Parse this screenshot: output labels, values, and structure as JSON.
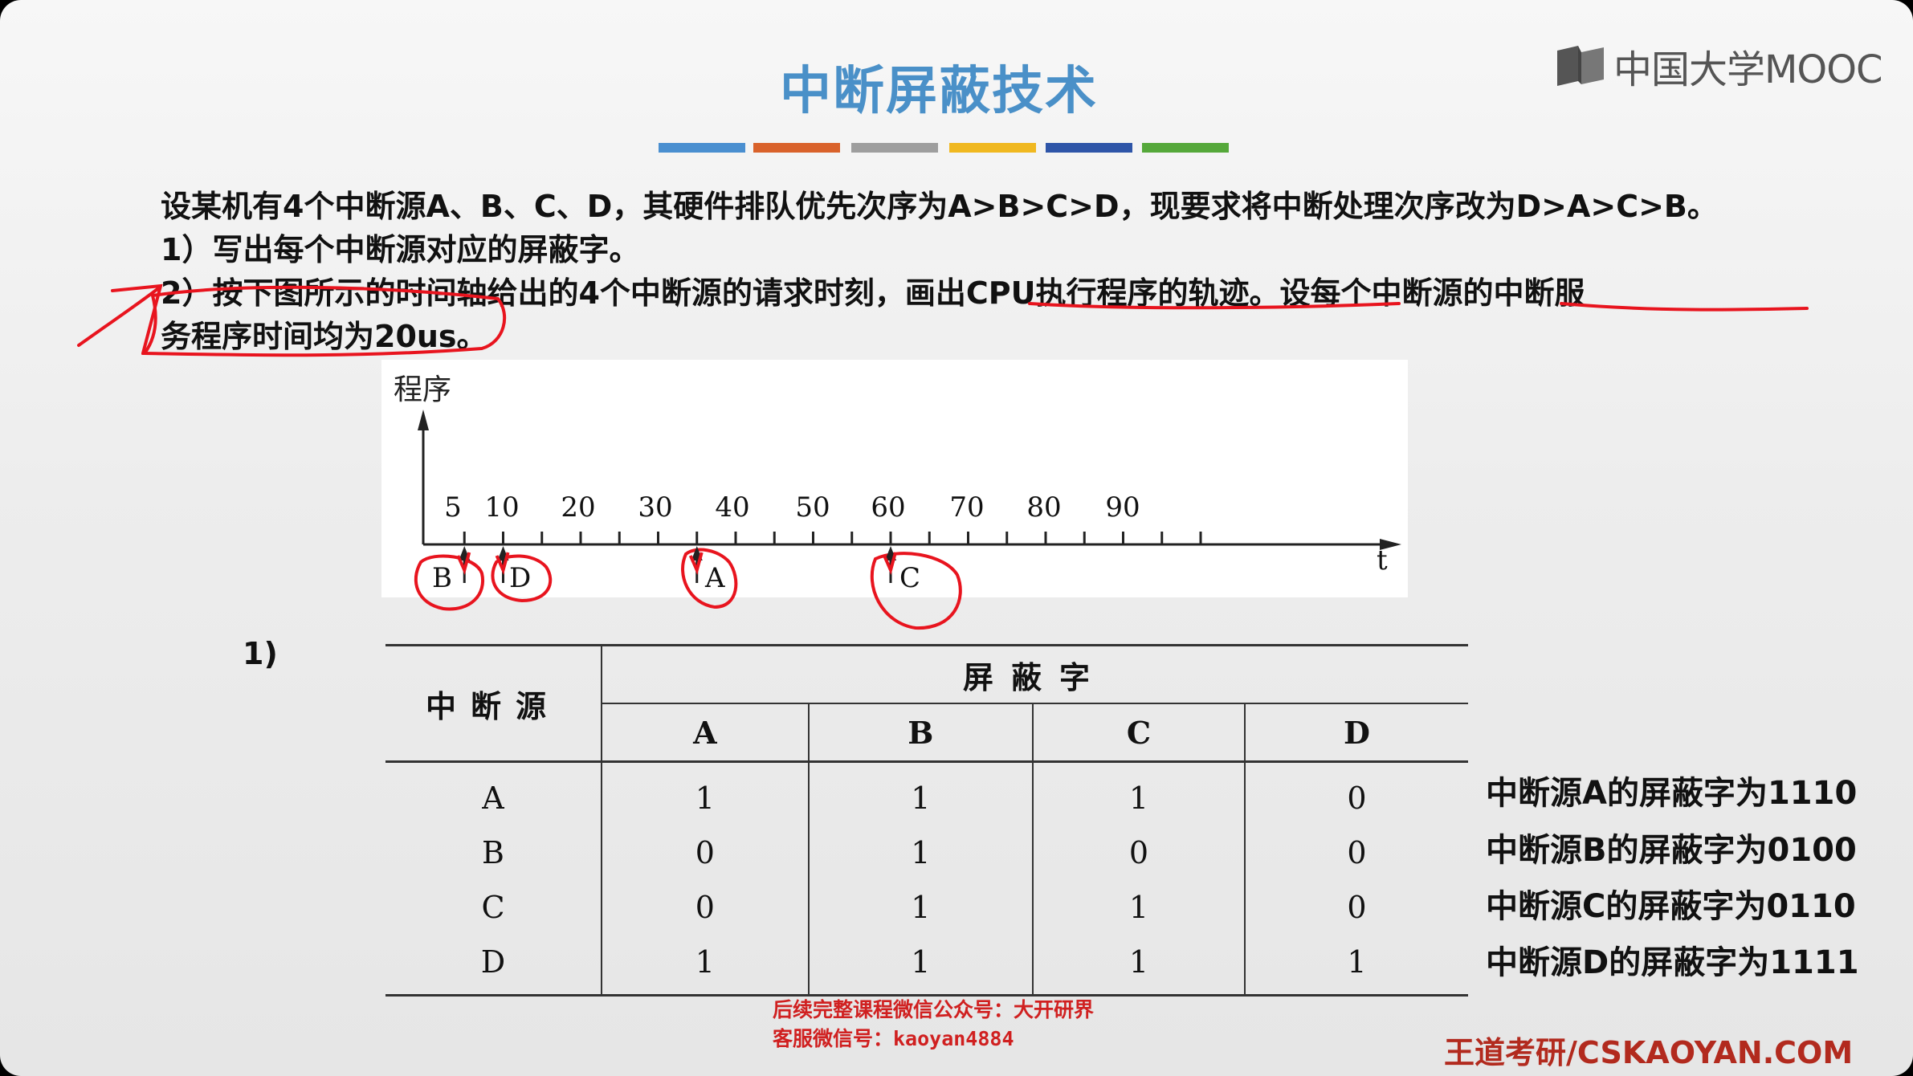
{
  "slide": {
    "title": "中断屏蔽技术",
    "title_color": "#4a90c8",
    "color_bar": [
      "#4a8fd0",
      "#d9622b",
      "#9e9e9e",
      "#f0b820",
      "#2e55a8",
      "#55a83a"
    ],
    "logo": {
      "icon": "book-icon",
      "text": "中国大学MOOC"
    }
  },
  "problem": {
    "line1": "设某机有4个中断源A、B、C、D，其硬件排队优先次序为A>B>C>D，现要求将中断处理次序改为D>A>C>B。",
    "line2": "1）写出每个中断源对应的屏蔽字。",
    "line3": "2）按下图所示的时间轴给出的4个中断源的请求时刻，画出CPU执行程序的轨迹。设每个中断源的中断服",
    "line4": "务程序时间均为20us。"
  },
  "timeline": {
    "y_label": "程序",
    "x_label": "t",
    "tick_labels": [
      "5",
      "10",
      "20",
      "30",
      "40",
      "50",
      "60",
      "70",
      "80",
      "90"
    ],
    "requests": [
      {
        "source": "B",
        "time": 5
      },
      {
        "source": "D",
        "time": 10
      },
      {
        "source": "A",
        "time": 35
      },
      {
        "source": "C",
        "time": 60
      }
    ]
  },
  "part1_label": "1)",
  "mask_table": {
    "header_source": "中断源",
    "header_mask": "屏蔽字",
    "columns": [
      "A",
      "B",
      "C",
      "D"
    ],
    "rows": [
      {
        "source": "A",
        "bits": [
          "1",
          "1",
          "1",
          "0"
        ]
      },
      {
        "source": "B",
        "bits": [
          "0",
          "1",
          "0",
          "0"
        ]
      },
      {
        "source": "C",
        "bits": [
          "0",
          "1",
          "1",
          "0"
        ]
      },
      {
        "source": "D",
        "bits": [
          "1",
          "1",
          "1",
          "1"
        ]
      }
    ]
  },
  "results": [
    "中断源A的屏蔽字为1110",
    "中断源B的屏蔽字为0100",
    "中断源C的屏蔽字为0110",
    "中断源D的屏蔽字为1111"
  ],
  "footer": {
    "promo_line1": "后续完整课程微信公众号：大开研界",
    "promo_line2": "客服微信号：kaoyan4884",
    "watermark": "王道考研/CSKAOYAN.COM"
  },
  "annotation_color": "#e8141e"
}
